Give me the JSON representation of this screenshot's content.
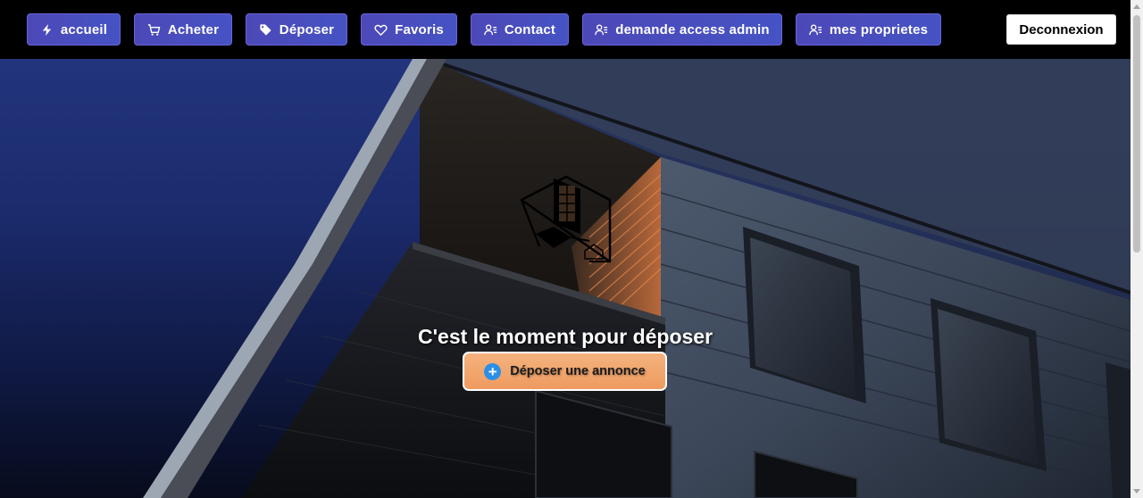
{
  "nav": {
    "items": [
      {
        "label": "accueil",
        "icon": "bolt-icon"
      },
      {
        "label": "Acheter",
        "icon": "cart-icon"
      },
      {
        "label": "Déposer",
        "icon": "tag-icon"
      },
      {
        "label": "Favoris",
        "icon": "heart-icon"
      },
      {
        "label": "Contact",
        "icon": "user-list-icon"
      },
      {
        "label": "demande access admin",
        "icon": "user-list-icon"
      },
      {
        "label": "mes proprietes",
        "icon": "user-list-icon"
      }
    ],
    "logout_label": "Deconnexion"
  },
  "hero": {
    "title": "C'est le moment pour déposer",
    "cta_label": "Déposer une annonce",
    "cta_icon": "plus-circle-icon"
  },
  "colors": {
    "nav_button": "#4d48b8",
    "cta_button": "#f0a068",
    "plus_icon": "#2b8fe8",
    "hero_sky": "#22347d"
  }
}
